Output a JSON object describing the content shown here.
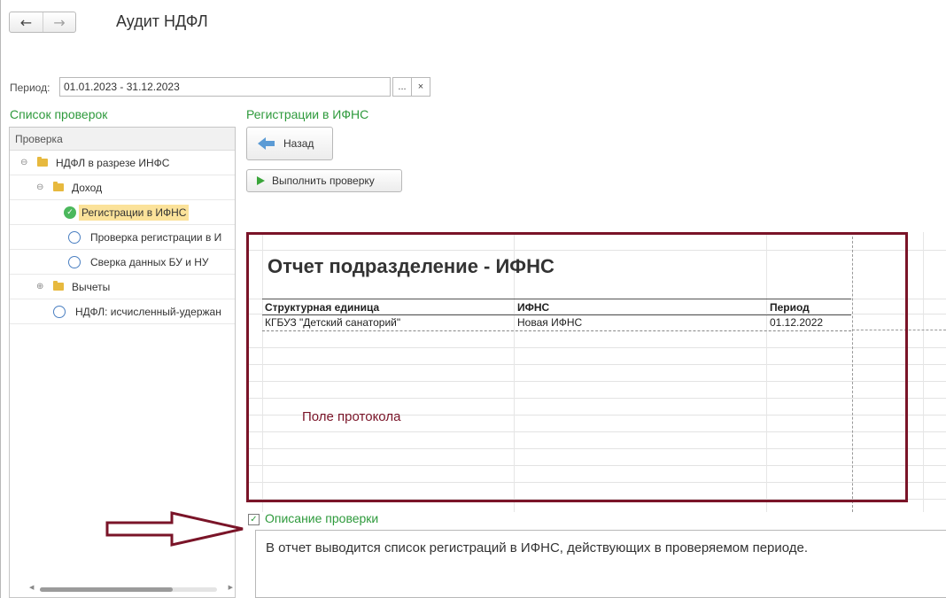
{
  "header": {
    "title": "Аудит НДФЛ",
    "back_icon": "←",
    "forward_icon": "→"
  },
  "period": {
    "label": "Период:",
    "value": "01.01.2023 - 31.12.2023",
    "select_label": "...",
    "clear_label": "×"
  },
  "checks_panel": {
    "title": "Список проверок",
    "column_header": "Проверка",
    "items": [
      {
        "label": "НДФЛ в разрезе ИНФС",
        "type": "folder",
        "expanded": true
      },
      {
        "label": "Доход",
        "type": "folder",
        "expanded": true
      },
      {
        "label": "Регистрации в ИФНС",
        "type": "check",
        "status": "passed",
        "selected": true
      },
      {
        "label": "Проверка регистрации в И",
        "type": "check",
        "status": "pending"
      },
      {
        "label": "Сверка данных БУ и НУ",
        "type": "check",
        "status": "pending"
      },
      {
        "label": "Вычеты",
        "type": "folder",
        "expanded": false
      },
      {
        "label": "НДФЛ: исчисленный-удержан",
        "type": "check",
        "status": "pending"
      }
    ]
  },
  "detail": {
    "title": "Регистрации в ИФНС",
    "back_button": "Назад",
    "run_button": "Выполнить проверку"
  },
  "report": {
    "title": "Отчет подразделение - ИФНС",
    "columns": [
      "Структурная единица",
      "ИФНС",
      "Период"
    ],
    "rows": [
      [
        "КГБУЗ \"Детский санаторий\"",
        "Новая ИФНС",
        "01.12.2022"
      ]
    ]
  },
  "annotations": {
    "protocol_field": "Поле протокола",
    "color": "#7a1428"
  },
  "description": {
    "title": "Описание проверки",
    "text": "В отчет выводится список регистраций в ИФНС, действующих в проверяемом периоде."
  },
  "colors": {
    "accent_green": "#2e9a3c",
    "selected_bg": "#fbe29a",
    "annotation": "#7a1428"
  }
}
